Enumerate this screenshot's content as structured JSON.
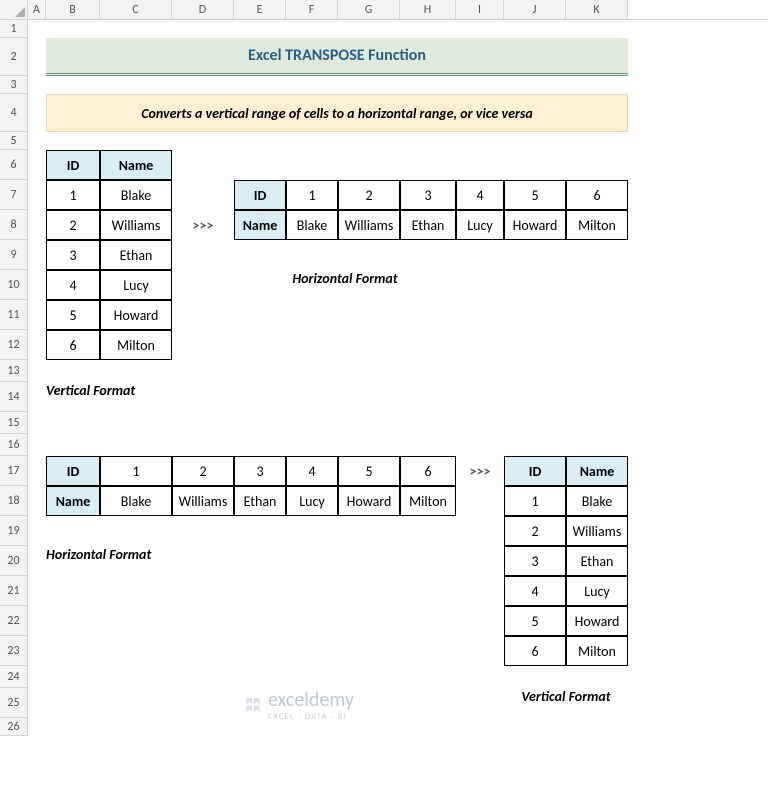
{
  "title": "Excel TRANSPOSE Function",
  "subtitle": "Converts a vertical range of cells to a horizontal range, or vice versa",
  "columns": [
    "A",
    "B",
    "C",
    "D",
    "E",
    "F",
    "G",
    "H",
    "I",
    "J",
    "K"
  ],
  "rows": [
    "1",
    "2",
    "3",
    "4",
    "5",
    "6",
    "7",
    "8",
    "9",
    "10",
    "11",
    "12",
    "13",
    "14",
    "15",
    "16",
    "17",
    "18",
    "19",
    "20",
    "21",
    "22",
    "23",
    "24",
    "25",
    "26"
  ],
  "labels": {
    "id": "ID",
    "name": "Name",
    "vertical": "Vertical Format",
    "horizontal": "Horizontal Format",
    "arrow": ">>>"
  },
  "people": [
    {
      "id": "1",
      "name": "Blake"
    },
    {
      "id": "2",
      "name": "Williams"
    },
    {
      "id": "3",
      "name": "Ethan"
    },
    {
      "id": "4",
      "name": "Lucy"
    },
    {
      "id": "5",
      "name": "Howard"
    },
    {
      "id": "6",
      "name": "Milton"
    }
  ],
  "watermark": {
    "name": "exceldemy",
    "sub": "EXCEL · DATA · BI"
  },
  "col_widths": {
    "A": 18,
    "B": 54,
    "C": 72,
    "D": 62,
    "E": 52,
    "F": 52,
    "G": 62,
    "H": 56,
    "I": 48,
    "J": 62,
    "K": 62
  },
  "row_heights": {
    "1": 18,
    "2": 38,
    "3": 18,
    "4": 38,
    "5": 18,
    "6": 30,
    "7": 30,
    "8": 30,
    "9": 30,
    "10": 30,
    "11": 30,
    "12": 30,
    "13": 22,
    "14": 30,
    "15": 22,
    "16": 22,
    "17": 30,
    "18": 30,
    "19": 30,
    "20": 30,
    "21": 30,
    "22": 30,
    "23": 30,
    "24": 22,
    "25": 30,
    "26": 18
  },
  "chart_data": {
    "type": "table",
    "title": "Excel TRANSPOSE Function",
    "description": "Vertical table of ID/Name pairs and its transposed horizontal form",
    "columns": [
      "ID",
      "Name"
    ],
    "rows": [
      [
        1,
        "Blake"
      ],
      [
        2,
        "Williams"
      ],
      [
        3,
        "Ethan"
      ],
      [
        4,
        "Lucy"
      ],
      [
        5,
        "Howard"
      ],
      [
        6,
        "Milton"
      ]
    ]
  }
}
